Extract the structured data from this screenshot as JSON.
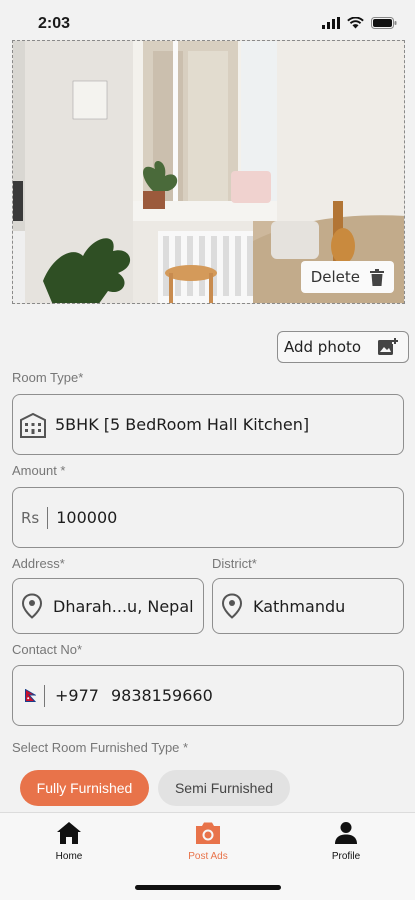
{
  "status": {
    "time": "2:03"
  },
  "photo": {
    "delete_label": "Delete"
  },
  "add_photo": {
    "label": "Add photo"
  },
  "room_type": {
    "label": "Room Type*",
    "value": "5BHK [5 BedRoom Hall Kitchen]"
  },
  "amount": {
    "label": "Amount *",
    "currency": "Rs",
    "value": "100000"
  },
  "address": {
    "label": "Address*",
    "value": "Dharah...u, Nepal"
  },
  "district": {
    "label": "District*",
    "value": "Kathmandu"
  },
  "contact": {
    "label": "Contact No*",
    "prefix": "+977",
    "value": "9838159660"
  },
  "furnished": {
    "label": "Select Room Furnished Type *",
    "options": [
      "Fully Furnished",
      "Semi Furnished"
    ],
    "selected": "Fully Furnished"
  },
  "nav": {
    "items": [
      {
        "label": "Home",
        "icon": "home-icon"
      },
      {
        "label": "Post Ads",
        "icon": "camera-icon",
        "active": true
      },
      {
        "label": "Profile",
        "icon": "person-icon"
      }
    ]
  },
  "colors": {
    "accent": "#e8734a",
    "border": "#8f8f8f",
    "background": "#f2f2f2"
  }
}
